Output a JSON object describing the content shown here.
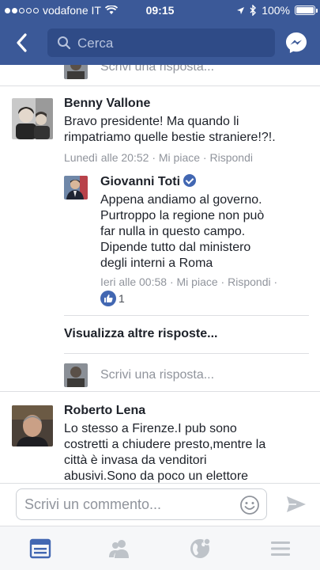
{
  "status_bar": {
    "carrier": "vodafone IT",
    "time": "09:15",
    "battery": "100%"
  },
  "nav": {
    "search_placeholder": "Cerca"
  },
  "top_reply": {
    "placeholder": "Scrivi una risposta..."
  },
  "comment1": {
    "author": "Benny Vallone",
    "text_lines": [
      "Bravo presidente! Ma quando li",
      "rimpatriamo quelle bestie straniere!?!."
    ],
    "time": "Lunedì alle 20:52",
    "like": "Mi piace",
    "reply": "Rispondi"
  },
  "reply1": {
    "author": "Giovanni Toti",
    "text_lines": [
      "Appena andiamo al governo.",
      "Purtroppo la regione non può",
      "far nulla in questo campo.",
      "Dipende tutto dal ministero",
      "degli interni a Roma"
    ],
    "time": "Ieri alle 00:58",
    "like": "Mi piace",
    "reply": "Rispondi",
    "like_count": "1"
  },
  "more_replies": "Visualizza altre risposte...",
  "reply_box": {
    "placeholder": "Scrivi una risposta..."
  },
  "comment2": {
    "author": "Roberto Lena",
    "text_lines": [
      "Lo stesso a Firenze.I pub sono",
      "costretti a chiudere presto,mentre la",
      "città è invasa da venditori",
      "abusivi.Sono da poco un elettore"
    ]
  },
  "composer": {
    "placeholder": "Scrivi un commento..."
  },
  "colors": {
    "brand": "#3b5998",
    "link_blue": "#4267b2",
    "meta_gray": "#90949c"
  },
  "icons": [
    "back-arrow-icon",
    "search-icon",
    "messenger-icon",
    "emoji-icon",
    "send-icon",
    "news-feed-icon",
    "friends-icon",
    "globe-icon",
    "menu-icon"
  ]
}
